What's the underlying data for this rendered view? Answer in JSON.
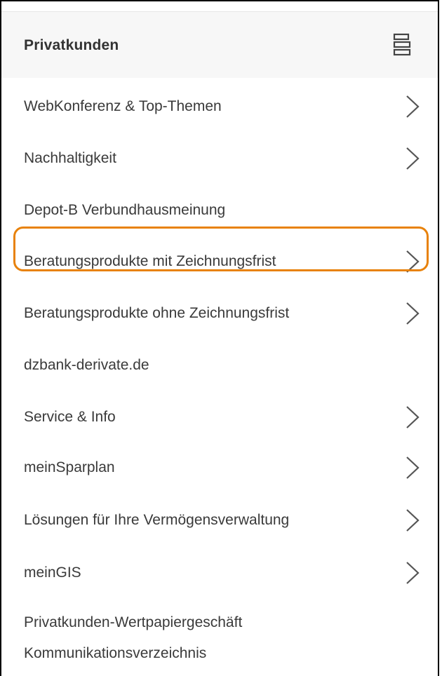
{
  "header": {
    "title": "Privatkunden",
    "menu_icon": "stacked-layers-icon"
  },
  "menu": {
    "items": [
      {
        "label": "WebKonferenz & Top-Themen",
        "has_submenu": true
      },
      {
        "label": "Nachhaltigkeit",
        "has_submenu": true
      },
      {
        "label": "Depot-B Verbundhausmeinung",
        "has_submenu": false
      },
      {
        "label": "Beratungsprodukte mit Zeichnungsfrist",
        "has_submenu": true,
        "highlighted": true
      },
      {
        "label": "Beratungsprodukte ohne Zeichnungsfrist",
        "has_submenu": true
      },
      {
        "label": "dzbank-derivate.de",
        "has_submenu": false
      },
      {
        "label": "Service & Info",
        "has_submenu": true
      },
      {
        "label": "meinSparplan",
        "has_submenu": true
      },
      {
        "label": "Lösungen für Ihre Vermögensverwaltung",
        "has_submenu": true
      },
      {
        "label": "meinGIS",
        "has_submenu": true
      },
      {
        "label": "Privatkunden-Wertpapiergeschäft",
        "label_line2": "Kommunikationsverzeichnis",
        "has_submenu": false
      }
    ]
  },
  "colors": {
    "highlight": "#e8820c",
    "text": "#3a3a3a",
    "header_bg": "#f7f7f7"
  }
}
